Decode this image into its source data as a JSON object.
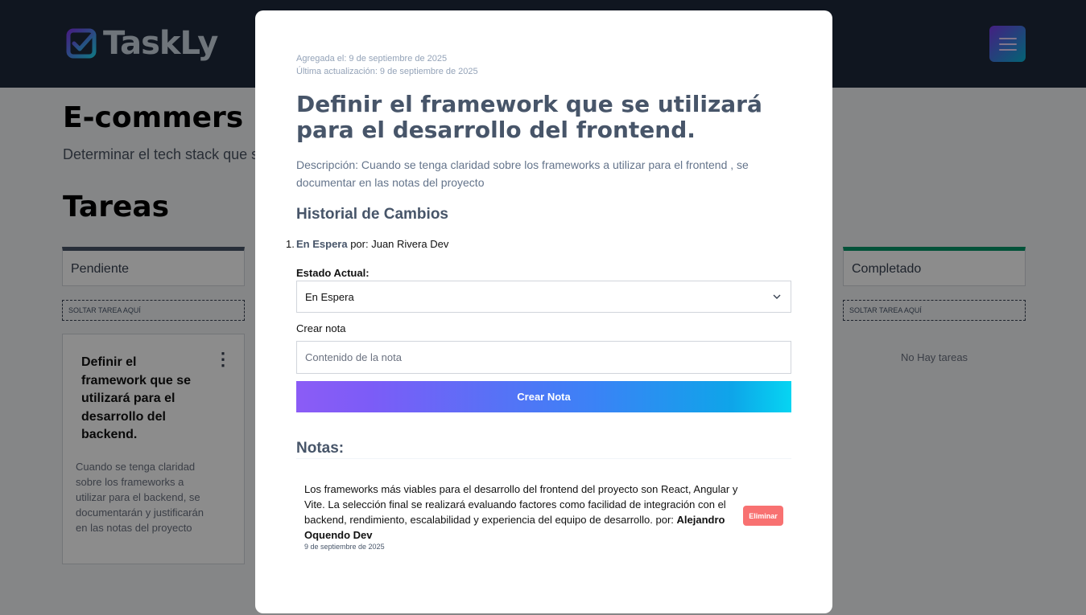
{
  "app": {
    "name": "TaskLy"
  },
  "project": {
    "title": "E-commers",
    "description": "Determinar el tech stack que s"
  },
  "board": {
    "title": "Tareas",
    "columns": [
      {
        "name": "Pendiente",
        "drop_label": "SOLTAR TAREA AQUÍ",
        "accent": "#475569"
      },
      {
        "name": "Completado",
        "drop_label": "SOLTAR TAREA AQUÍ",
        "accent": "#059669",
        "empty_text": "No Hay tareas"
      }
    ],
    "task_card": {
      "title": "Definir el framework que se utilizará para el desarrollo del backend.",
      "kebab": "⋮",
      "description": "Cuando se tenga claridad sobre los frameworks a utilizar para el backend, se documentarán y justificarán en las notas del proyecto"
    }
  },
  "modal": {
    "added": "Agregada el: 9 de septiembre de 2025",
    "updated": "Última actualización: 9 de septiembre de 2025",
    "title": "Definir el framework que se utilizará para el desarrollo del frontend.",
    "description": "Descripción: Cuando se tenga claridad sobre los frameworks a utilizar para el frontend , se documentar en las notas del proyecto",
    "history_title": "Historial de Cambios",
    "history": [
      {
        "number": "1.",
        "status": "En Espera",
        "by": " por: Juan Rivera Dev"
      }
    ],
    "state_label": "Estado Actual:",
    "state_value": "En Espera",
    "note_label": "Crear nota",
    "note_placeholder": "Contenido de la nota",
    "create_button": "Crear Nota",
    "notes_title": "Notas:",
    "notes": [
      {
        "content": "Los frameworks más viables para el desarrollo del frontend del proyecto son React, Angular y Vite. La selección final se realizará evaluando factores como facilidad de integración con el backend, rendimiento, escalabilidad y experiencia del equipo de desarrollo. por: ",
        "author": "Alejandro Oquendo Dev",
        "date": "9 de septiembre de 2025",
        "delete_label": "Eliminar"
      }
    ]
  },
  "colors": {
    "topbar": "#1e293b",
    "accent_gradient_start": "#8b5cf6",
    "accent_gradient_end": "#06d5f2",
    "delete": "#f87171"
  }
}
